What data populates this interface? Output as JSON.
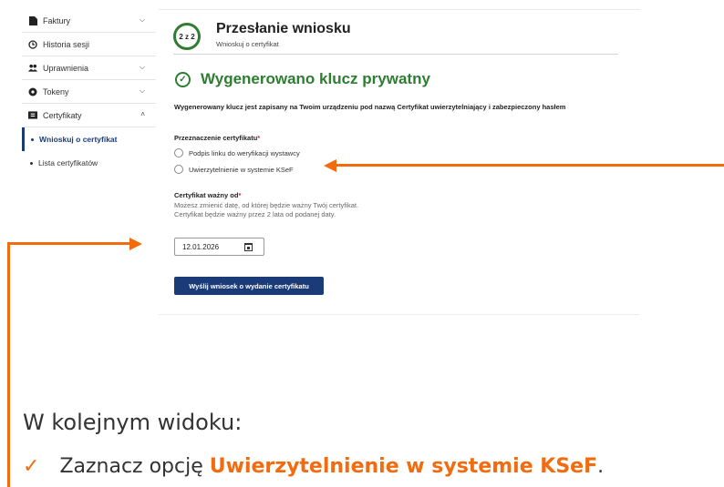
{
  "sidebar": {
    "items": [
      {
        "label": "Faktury",
        "icon": "document-icon"
      },
      {
        "label": "Historia sesji",
        "icon": "clock-icon"
      },
      {
        "label": "Uprawnienia",
        "icon": "users-icon"
      },
      {
        "label": "Tokeny",
        "icon": "token-icon"
      },
      {
        "label": "Certyfikaty",
        "icon": "certificate-icon"
      }
    ],
    "sub_items": [
      {
        "label": "Wnioskuj o certyfikat",
        "active": true
      },
      {
        "label": "Lista certyfikatów",
        "active": false
      }
    ]
  },
  "header": {
    "step": "2 z 2",
    "title": "Przesłanie wniosku",
    "subtitle": "Wnioskuj o certyfikat"
  },
  "success": {
    "title": "Wygenerowano klucz prywatny"
  },
  "description": "Wygenerowany klucz jest zapisany na Twoim urządzeniu pod nazwą Certyfikat uwierzytelniający i zabezpieczony hasłem",
  "purpose": {
    "label": "Przeznaczenie certyfikatu",
    "required": "*",
    "options": [
      "Podpis linku do weryfikacji wystawcy",
      "Uwierzytelnienie w systemie KSeF"
    ]
  },
  "valid_from": {
    "label": "Certyfikat ważny od",
    "required": "*",
    "help": "Możesz zmienić datę, od której będzie ważny Twój certyfikat. Certyfikat będzie ważny przez 2 lata od podanej daty.",
    "value": "12.01.2026"
  },
  "submit_label": "Wyślij wniosek o wydanie certyfikatu",
  "instruction": {
    "heading": "W kolejnym widoku:",
    "tick": "✓",
    "prefix": "Zaznacz opcję ",
    "highlight": "Uwierzytelnienie w systemie KSeF",
    "suffix": "."
  },
  "colors": {
    "accent": "#1a3b78",
    "success": "#2e7d32",
    "annotation": "#f26b0f",
    "required": "#c62828"
  }
}
